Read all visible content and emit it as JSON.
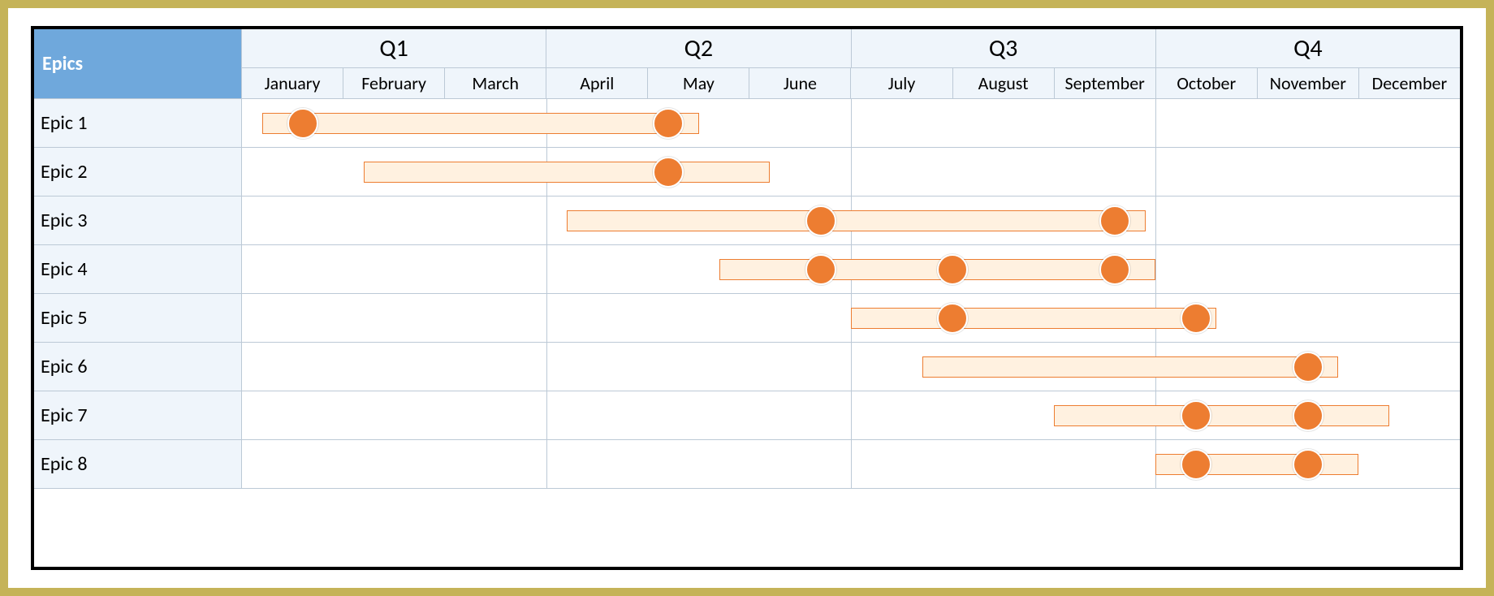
{
  "header": {
    "epics_label": "Epics",
    "quarters": [
      "Q1",
      "Q2",
      "Q3",
      "Q4"
    ],
    "months": [
      "January",
      "February",
      "March",
      "April",
      "May",
      "June",
      "July",
      "August",
      "September",
      "October",
      "November",
      "December"
    ]
  },
  "rows": [
    {
      "label": "Epic 1",
      "start": 0.2,
      "end": 4.5,
      "markers": [
        0.6,
        4.2
      ]
    },
    {
      "label": "Epic 2",
      "start": 1.2,
      "end": 5.2,
      "markers": [
        4.2
      ]
    },
    {
      "label": "Epic 3",
      "start": 3.2,
      "end": 8.9,
      "markers": [
        5.7,
        8.6
      ]
    },
    {
      "label": "Epic 4",
      "start": 4.7,
      "end": 9.0,
      "markers": [
        5.7,
        7.0,
        8.6
      ]
    },
    {
      "label": "Epic 5",
      "start": 6.0,
      "end": 9.6,
      "markers": [
        7.0,
        9.4
      ]
    },
    {
      "label": "Epic 6",
      "start": 6.7,
      "end": 10.8,
      "markers": [
        10.5
      ]
    },
    {
      "label": "Epic 7",
      "start": 8.0,
      "end": 11.3,
      "markers": [
        9.4,
        10.5
      ]
    },
    {
      "label": "Epic 8",
      "start": 9.0,
      "end": 11.0,
      "markers": [
        9.4,
        10.5
      ]
    }
  ],
  "chart_data": {
    "type": "bar",
    "title": "",
    "xlabel": "",
    "ylabel": "",
    "x_categories": [
      "January",
      "February",
      "March",
      "April",
      "May",
      "June",
      "July",
      "August",
      "September",
      "October",
      "November",
      "December"
    ],
    "x_groups": [
      {
        "name": "Q1",
        "months": [
          "January",
          "February",
          "March"
        ]
      },
      {
        "name": "Q2",
        "months": [
          "April",
          "May",
          "June"
        ]
      },
      {
        "name": "Q3",
        "months": [
          "July",
          "August",
          "September"
        ]
      },
      {
        "name": "Q4",
        "months": [
          "October",
          "November",
          "December"
        ]
      }
    ],
    "series": [
      {
        "name": "Epic 1",
        "start_month": "January",
        "end_month": "May",
        "milestones": [
          "January",
          "May"
        ]
      },
      {
        "name": "Epic 2",
        "start_month": "February",
        "end_month": "June",
        "milestones": [
          "May"
        ]
      },
      {
        "name": "Epic 3",
        "start_month": "April",
        "end_month": "September",
        "milestones": [
          "June",
          "September"
        ]
      },
      {
        "name": "Epic 4",
        "start_month": "May",
        "end_month": "September",
        "milestones": [
          "June",
          "August",
          "September"
        ]
      },
      {
        "name": "Epic 5",
        "start_month": "July",
        "end_month": "October",
        "milestones": [
          "August",
          "October"
        ]
      },
      {
        "name": "Epic 6",
        "start_month": "July",
        "end_month": "November",
        "milestones": [
          "November"
        ]
      },
      {
        "name": "Epic 7",
        "start_month": "September",
        "end_month": "December",
        "milestones": [
          "October",
          "November"
        ]
      },
      {
        "name": "Epic 8",
        "start_month": "October",
        "end_month": "November",
        "milestones": [
          "October",
          "November"
        ]
      }
    ],
    "xlim": [
      1,
      12
    ]
  },
  "colors": {
    "accent": "#ed7d31",
    "header_blue": "#6fa8dc",
    "panel_bg": "#eff5fb"
  }
}
